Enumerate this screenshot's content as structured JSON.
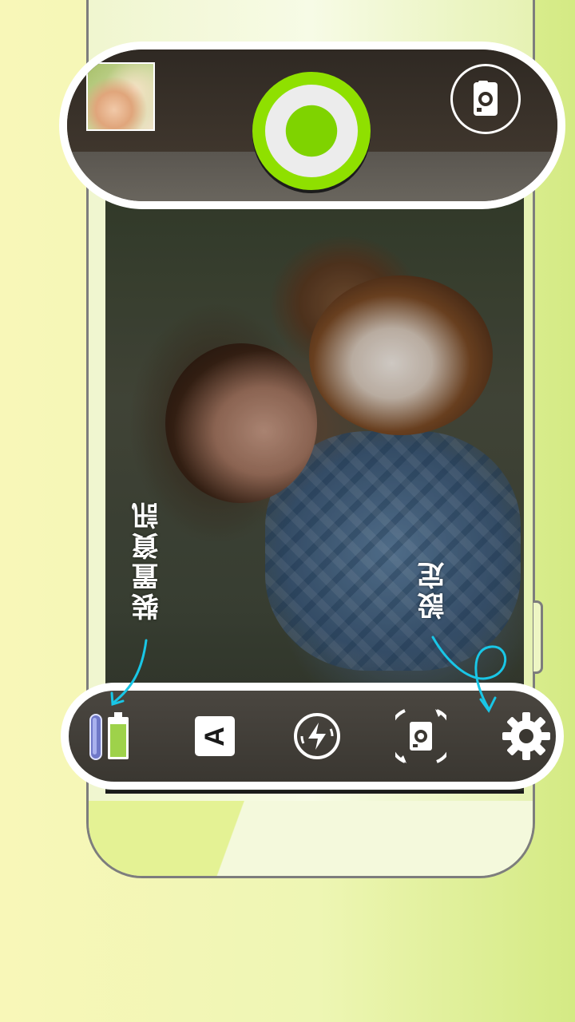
{
  "annotations": {
    "device_info": "裝置資訊",
    "settings": "設定"
  },
  "icons": {
    "gallery": "gallery-thumbnail",
    "shutter": "shutter-button",
    "switch_camera": "camera-switch-icon",
    "battery": "battery-icon",
    "auto_mode": "auto-mode-icon",
    "flash": "flash-auto-icon",
    "rotate": "rotate-camera-icon",
    "settings": "gear-icon"
  },
  "auto_mode_label": "A",
  "colors": {
    "accent": "#8fe000",
    "annotation_arrow": "#19c6e6",
    "bar_border": "#ffffff"
  }
}
